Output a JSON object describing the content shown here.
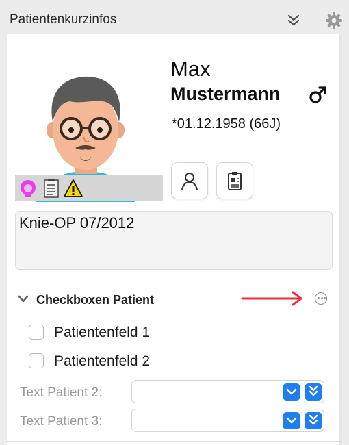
{
  "header": {
    "title": "Patientenkurzinfos"
  },
  "patient": {
    "first_name": "Max",
    "last_name": "Mustermann",
    "birth": "*01.12.1958 (66J)",
    "gender_icon": "male-symbol-icon"
  },
  "note": {
    "text": "Knie-OP 07/2012"
  },
  "section": {
    "title": "Checkboxen Patient",
    "checkboxes": [
      {
        "label": "Patientenfeld 1",
        "checked": false
      },
      {
        "label": "Patientenfeld 2",
        "checked": false
      }
    ],
    "fields": [
      {
        "label": "Text Patient 2:",
        "value": ""
      },
      {
        "label": "Text Patient 3:",
        "value": ""
      }
    ]
  },
  "colors": {
    "accent_blue": "#1f7ff0",
    "annotation_red": "#e8333c",
    "warning_yellow": "#f5d800",
    "icon_magenta": "#e83ee8",
    "avatar_shirt": "#2db9d8"
  }
}
